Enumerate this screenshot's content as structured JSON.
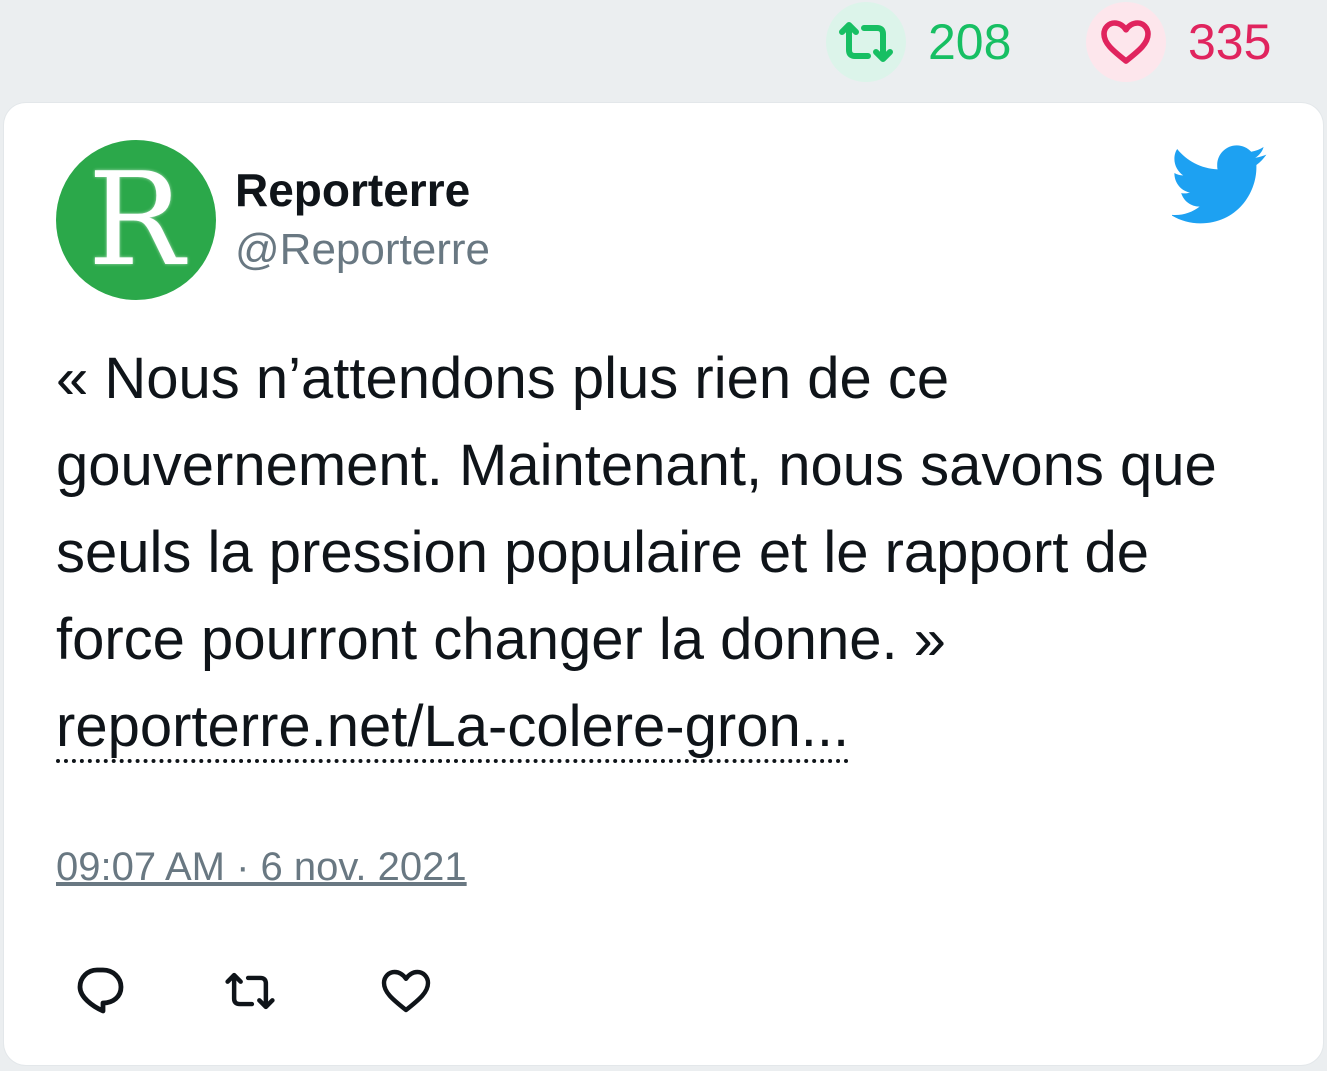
{
  "stats": {
    "retweet_icon": "retweet-icon",
    "retweet_count": "208",
    "like_icon": "heart-icon",
    "like_count": "335",
    "retweet_color": "#17bf63",
    "like_color": "#e0245e"
  },
  "tweet": {
    "avatar_letter": "R",
    "avatar_color": "#2ba84a",
    "display_name": "Reporterre",
    "handle": "@Reporterre",
    "text": "« Nous n’attendons plus rien de ce gouvernement. Maintenant, nous savons que seuls la pression populaire et le rapport de force pourront changer la donne. » ",
    "link_text": "reporterre.net/La-colere-gron...",
    "timestamp": "09:07 AM · 6 nov. 2021",
    "brand_icon": "twitter-bird-icon",
    "brand_color": "#1da1f2"
  },
  "actions": {
    "reply_icon": "reply-icon",
    "retweet_icon": "retweet-icon",
    "like_icon": "heart-icon"
  }
}
